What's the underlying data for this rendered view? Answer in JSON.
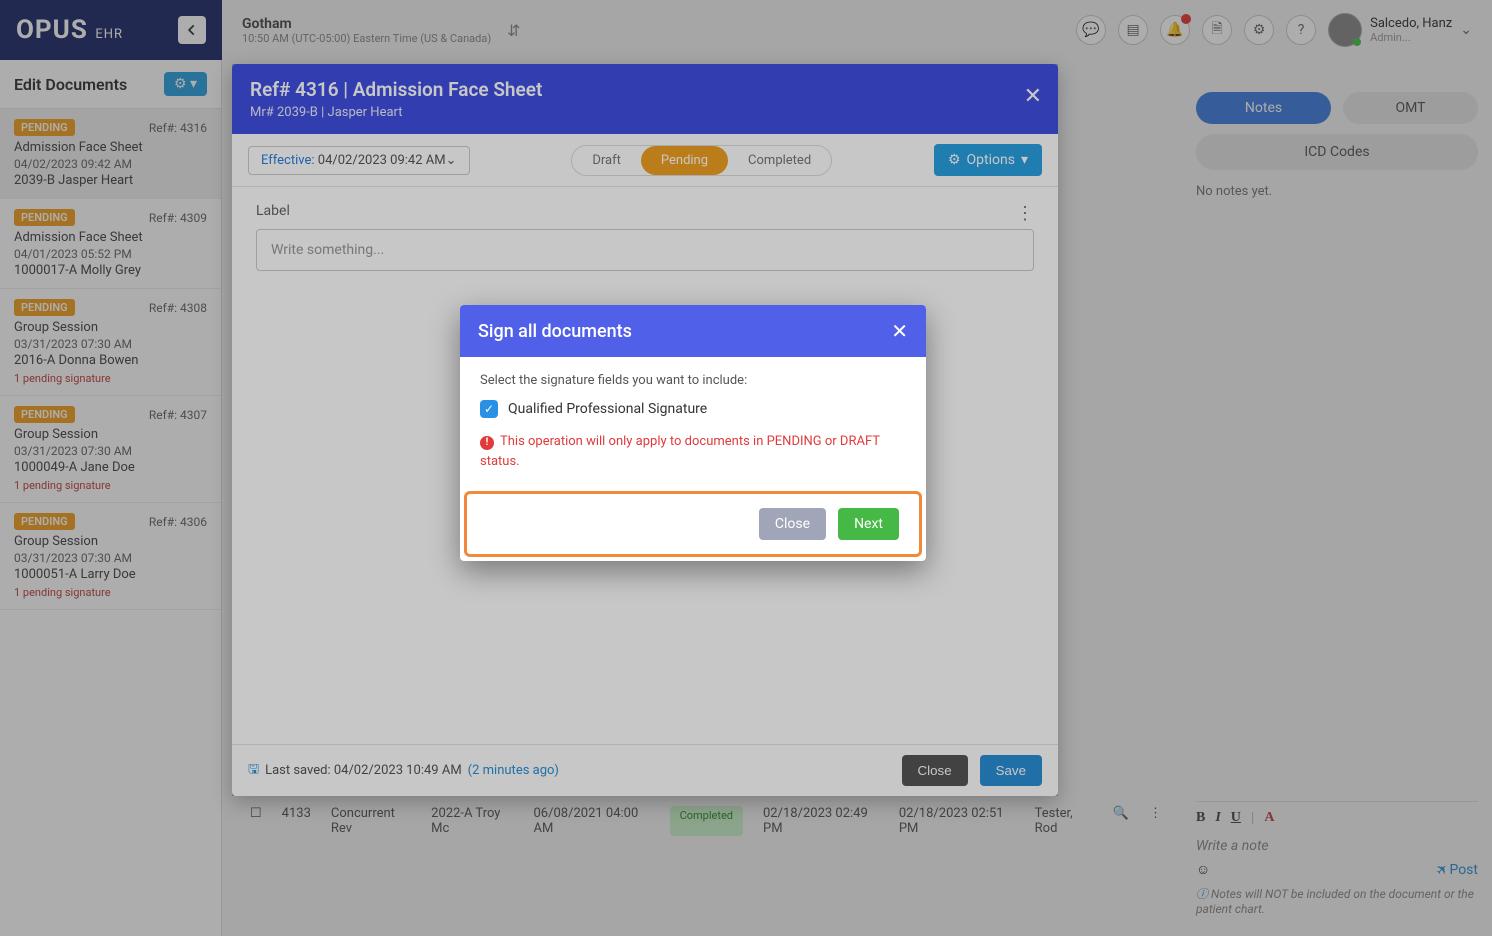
{
  "logo": {
    "brand": "OPUS",
    "sub": "EHR"
  },
  "facility": {
    "name": "Gotham",
    "tz": "10:50 AM (UTC-05:00) Eastern Time (US & Canada)"
  },
  "user": {
    "name": "Salcedo, Hanz",
    "role": "Admin..."
  },
  "sidebar": {
    "title": "Edit Documents",
    "items": [
      {
        "status": "PENDING",
        "ref": "Ref#: 4316",
        "title": "Admission Face Sheet",
        "date": "04/02/2023 09:42 AM",
        "pt": "2039-B Jasper Heart",
        "sig": ""
      },
      {
        "status": "PENDING",
        "ref": "Ref#: 4309",
        "title": "Admission Face Sheet",
        "date": "04/01/2023 05:52 PM",
        "pt": "1000017-A Molly Grey",
        "sig": ""
      },
      {
        "status": "PENDING",
        "ref": "Ref#: 4308",
        "title": "Group Session",
        "date": "03/31/2023 07:30 AM",
        "pt": "2016-A Donna Bowen",
        "sig": "1 pending signature"
      },
      {
        "status": "PENDING",
        "ref": "Ref#: 4307",
        "title": "Group Session",
        "date": "03/31/2023 07:30 AM",
        "pt": "1000049-A Jane Doe",
        "sig": "1 pending signature"
      },
      {
        "status": "PENDING",
        "ref": "Ref#: 4306",
        "title": "Group Session",
        "date": "03/31/2023 07:30 AM",
        "pt": "1000051-A Larry Doe",
        "sig": "1 pending signature"
      }
    ]
  },
  "rightPanel": {
    "tab1": "Notes",
    "tab2": "OMT",
    "icd": "ICD Codes",
    "empty": "No notes yet.",
    "writePlaceholder": "Write a note",
    "postLabel": "Post",
    "disclaimer": "Notes will NOT be included on the document or the patient chart."
  },
  "panel": {
    "title": "Ref# 4316 | Admission Face Sheet",
    "sub": "Mr# 2039-B | Jasper Heart",
    "effectiveLabel": "Effective:",
    "effectiveValue": "04/02/2023 09:42 AM",
    "statusDraft": "Draft",
    "statusPending": "Pending",
    "statusCompleted": "Completed",
    "optionsLabel": "Options",
    "labelText": "Label",
    "labelPlaceholder": "Write something...",
    "lastSaved": "Last saved: 04/02/2023 10:49 AM ",
    "lastSavedAgo": "(2 minutes ago)",
    "closeBtn": "Close",
    "saveBtn": "Save"
  },
  "modal2": {
    "title": "Sign all documents",
    "text": "Select the signature fields you want to include:",
    "chkLabel": "Qualified Professional Signature",
    "warn": "This operation will only apply to documents in PENDING or DRAFT status.",
    "closeBtn": "Close",
    "nextBtn": "Next"
  },
  "bottomRow": {
    "ref": "4133",
    "formName": "Concurrent Rev",
    "patient": "2022-A Troy Mc",
    "serviceDate": "06/08/2021 04:00 AM",
    "status": "Completed",
    "created": "02/18/2023 02:49 PM",
    "updated": "02/18/2023 02:51 PM",
    "by": "Tester, Rod"
  }
}
